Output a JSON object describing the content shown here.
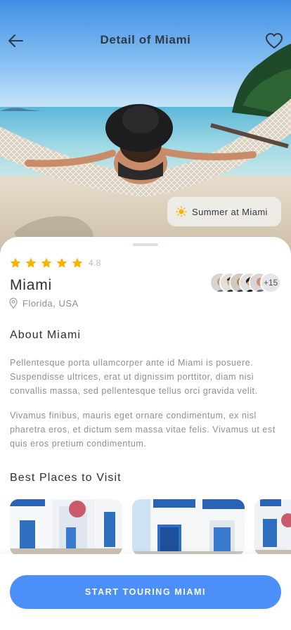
{
  "header": {
    "title": "Detail of Miami",
    "back_icon": "arrow-left-icon",
    "favorite_icon": "heart-icon"
  },
  "hero": {
    "season_label": "Summer at Miami",
    "season_icon": "sun-icon"
  },
  "destination": {
    "rating_stars": 5,
    "rating_value": "4.8",
    "name": "Miami",
    "location": "Florida, USA",
    "location_icon": "map-pin-icon",
    "visitors_more": "+15"
  },
  "about": {
    "title": "About Miami",
    "paragraph1": "Pellentesque porta ullamcorper ante id Miami is posuere. Suspendisse ultrices, erat ut dignissim porttitor, diam nisi convallis massa, sed pellentesque tellus orci gravida velit.",
    "paragraph2": "Vivamus finibus, mauris eget ornare condimentum, ex nisl pharetra eros, et dictum sem massa vitae felis. Vivamus ut est quis eros pretium condimentum."
  },
  "places": {
    "title": "Best Places to Visit"
  },
  "cta": {
    "label": "START TOURING MIAMI"
  },
  "colors": {
    "accent": "#4c8ff8",
    "star": "#f5b400",
    "muted_text": "#8d9096"
  }
}
